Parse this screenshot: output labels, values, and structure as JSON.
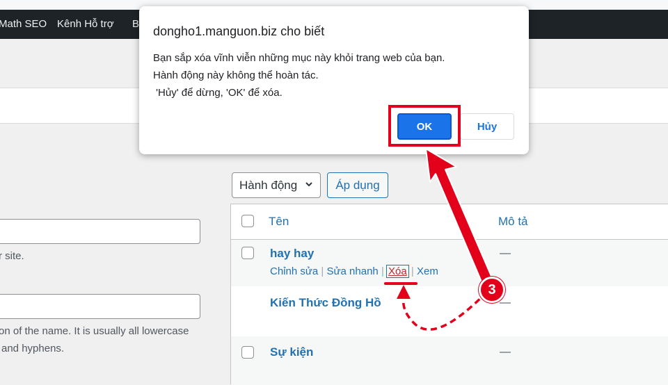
{
  "adminbar": {
    "items": [
      "Math SEO",
      "Kênh Hỗ trợ",
      "B"
    ]
  },
  "left_form": {
    "help1": "r site.",
    "help2_line1": "on of the name. It is usually all lowercase",
    "help2_line2": "and hyphens."
  },
  "toolbar": {
    "bulk_action": "Hành động",
    "apply": "Áp dụng"
  },
  "table": {
    "columns": [
      "Tên",
      "Mô tả"
    ],
    "rows": [
      {
        "title": "hay hay",
        "desc": "—",
        "actions": [
          "Chỉnh sửa",
          "Sửa nhanh",
          "Xóa",
          "Xem"
        ]
      },
      {
        "title": "Kiến Thức Đồng Hồ",
        "desc": "—"
      },
      {
        "title": "Sự kiện",
        "desc": "—"
      }
    ],
    "action_separator": "|"
  },
  "dialog": {
    "title": "dongho1.manguon.biz cho biết",
    "message": "Bạn sắp xóa vĩnh viễn những mục này khỏi trang web của bạn.\nHành động này không thể hoàn tác.\n 'Hủy' để dừng, 'OK' để xóa.",
    "ok": "OK",
    "cancel": "Hủy"
  },
  "annotation": {
    "step": "3",
    "color": "#e3001b"
  }
}
